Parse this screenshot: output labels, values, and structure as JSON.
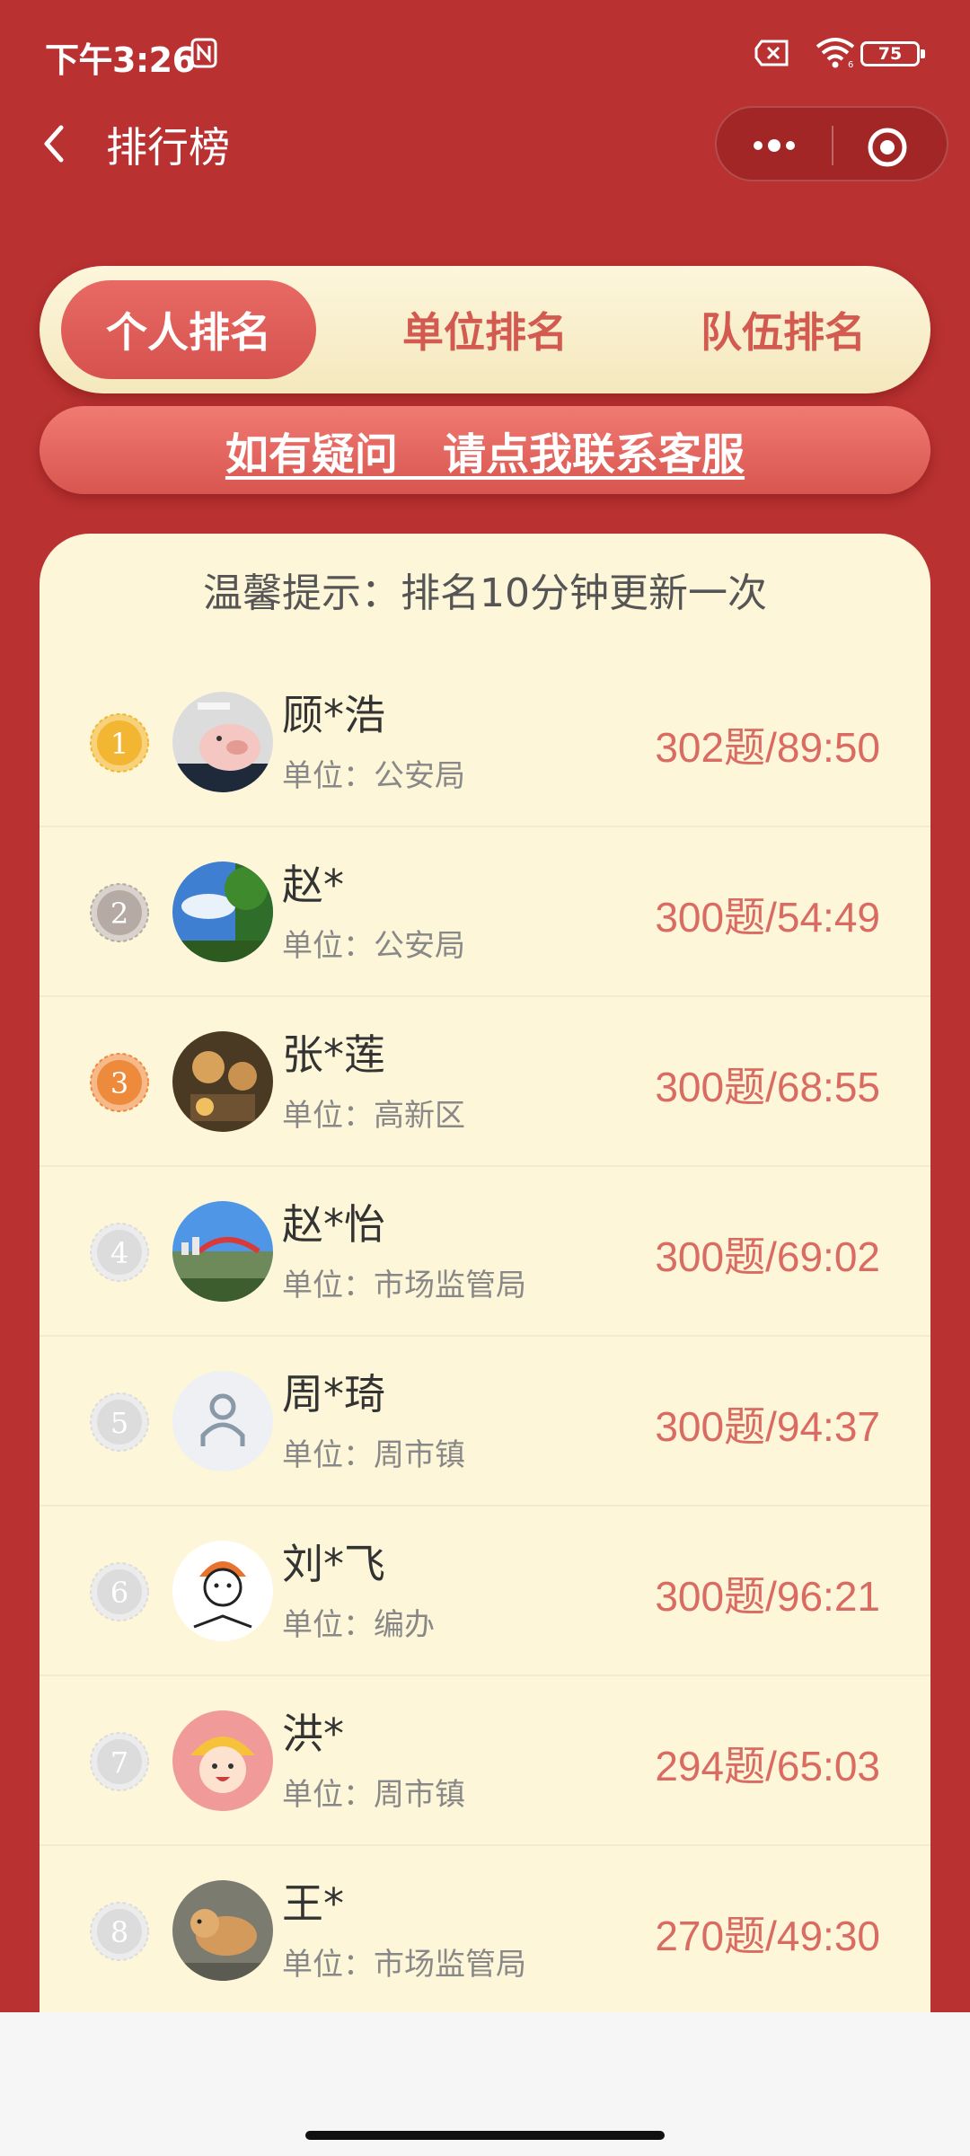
{
  "status_bar": {
    "time": "下午3:26",
    "battery": "75",
    "icons": [
      "nfc-icon",
      "sim-off-icon",
      "wifi-icon",
      "battery-icon"
    ]
  },
  "header": {
    "title": "排行榜",
    "icons": [
      "back-icon",
      "more-icon",
      "close-miniprogram-icon"
    ]
  },
  "tabs": [
    {
      "label": "个人排名",
      "active": true
    },
    {
      "label": "单位排名",
      "active": false
    },
    {
      "label": "队伍排名",
      "active": false
    }
  ],
  "contact": {
    "label": "如有疑问   请点我联系客服"
  },
  "tip": "温馨提示：排名10分钟更新一次",
  "rank_list": [
    {
      "rank": "1",
      "name": "顾*浩",
      "unit": "单位：公安局",
      "score": "302题/89:50",
      "avatar": "pig-photo"
    },
    {
      "rank": "2",
      "name": "赵*",
      "unit": "单位：公安局",
      "score": "300题/54:49",
      "avatar": "sky-tree-photo"
    },
    {
      "rank": "3",
      "name": "张*莲",
      "unit": "单位：高新区",
      "score": "300题/68:55",
      "avatar": "cafe-photo"
    },
    {
      "rank": "4",
      "name": "赵*怡",
      "unit": "单位：市场监管局",
      "score": "300题/69:02",
      "avatar": "city-bridge-photo"
    },
    {
      "rank": "5",
      "name": "周*琦",
      "unit": "单位：周市镇",
      "score": "300题/94:37",
      "avatar": "default-user-avatar"
    },
    {
      "rank": "6",
      "name": "刘*飞",
      "unit": "单位：编办",
      "score": "300题/96:21",
      "avatar": "cartoon-reader-avatar"
    },
    {
      "rank": "7",
      "name": "洪*",
      "unit": "单位：周市镇",
      "score": "294题/65:03",
      "avatar": "cartoon-tiger-girl-avatar"
    },
    {
      "rank": "8",
      "name": "王*",
      "unit": "单位：市场监管局",
      "score": "270题/49:30",
      "avatar": "dog-photo"
    }
  ],
  "colors": {
    "background": "#b93131",
    "accent": "#d6524e",
    "card": "#fdf6d8",
    "score": "#d96b62",
    "gold": "#f2b632",
    "silver": "#b5aaa4",
    "bronze": "#ee8a3c",
    "plain_medal": "#dcdcdc"
  }
}
